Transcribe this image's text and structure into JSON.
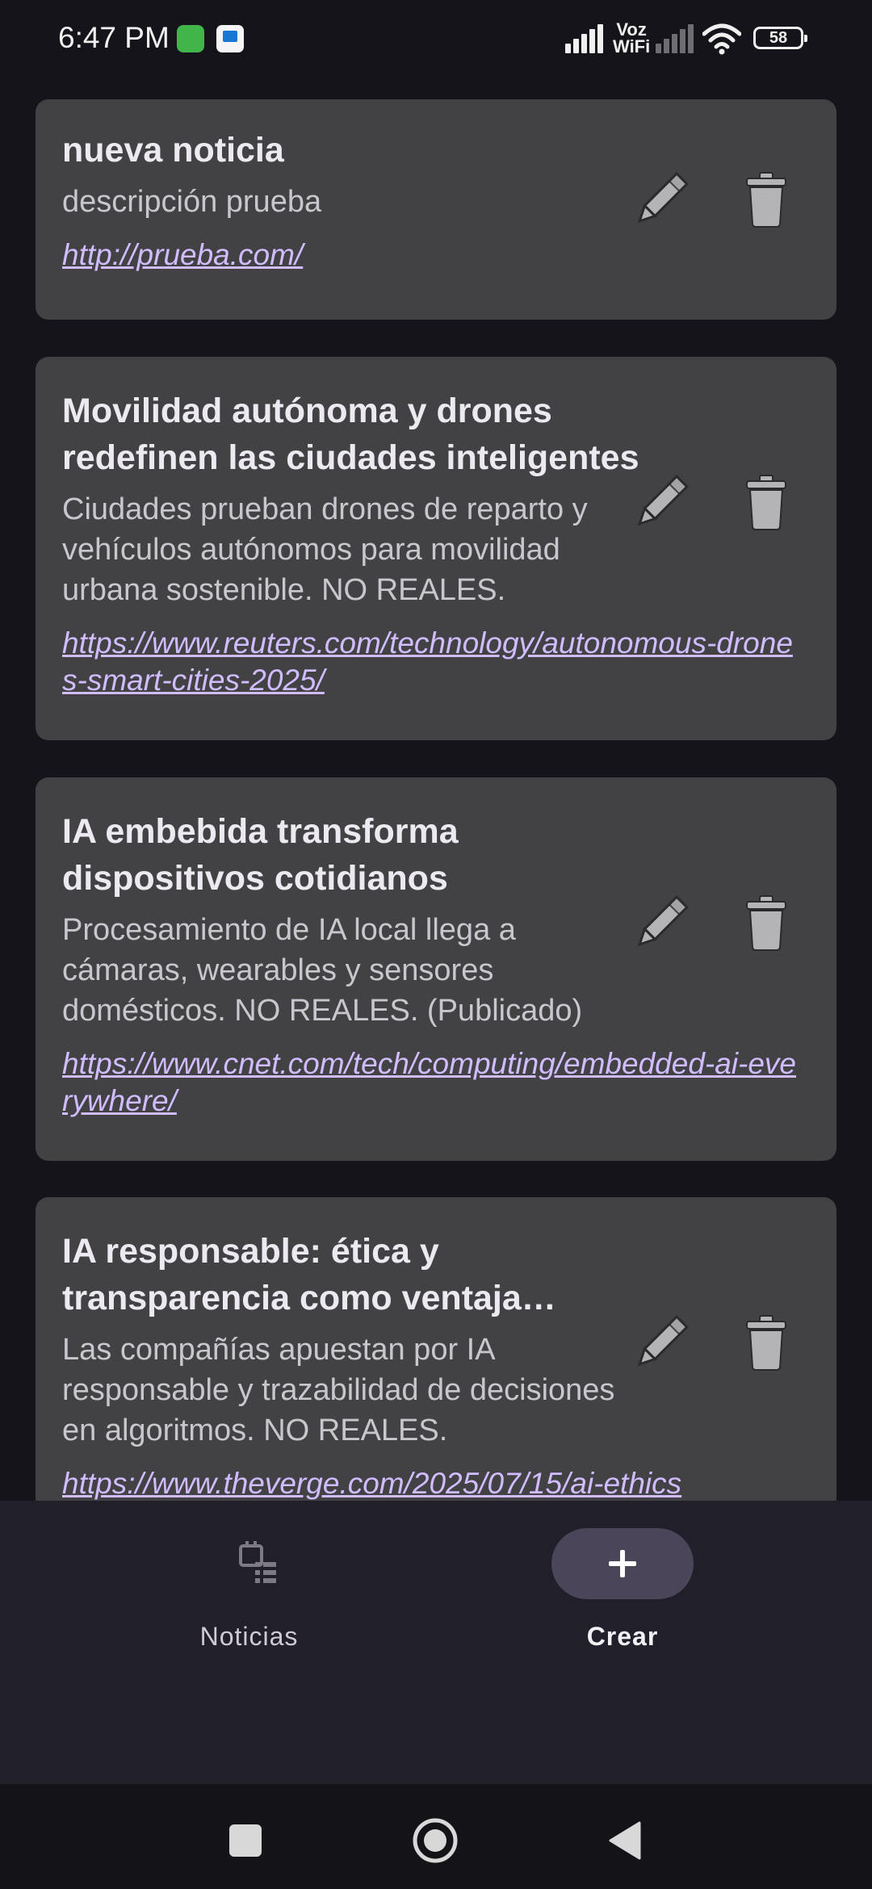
{
  "status_bar": {
    "time": "6:47 PM",
    "voz_line1": "Voz",
    "voz_line2": "WiFi",
    "battery": "58"
  },
  "news": [
    {
      "title": "nueva noticia",
      "description": "descripción prueba",
      "url": "http://prueba.com/"
    },
    {
      "title": "Movilidad autónoma y drones redefinen las ciudades inteligentes",
      "description": "Ciudades prueban drones de reparto y vehículos autónomos para movilidad urbana sostenible. NO REALES.",
      "url": "https://www.reuters.com/technology/autonomous-drones-smart-cities-2025/"
    },
    {
      "title": "IA embebida transforma dispositivos cotidianos",
      "description": "Procesamiento de IA local llega a cámaras, wearables y sensores domésticos. NO REALES. (Publicado)",
      "url": "https://www.cnet.com/tech/computing/embedded-ai-everywhere/"
    },
    {
      "title": "IA responsable: ética y transparencia como ventaja competitiva",
      "description": "Las compañías apuestan por IA responsable y trazabilidad de decisiones en algoritmos. NO REALES.",
      "url": "https://www.theverge.com/2025/07/15/ai-ethics"
    }
  ],
  "icons": {
    "edit": "pencil-icon",
    "delete": "trash-icon",
    "news_tab": "news-calendar-icon",
    "create_tab": "plus-icon"
  },
  "bottom_nav": {
    "news_label": "Noticias",
    "create_label": "Crear"
  },
  "colors": {
    "card_bg": "#424244",
    "link": "#d0bcff",
    "nav_bg": "#211f2a",
    "pill": "#4a4558"
  }
}
